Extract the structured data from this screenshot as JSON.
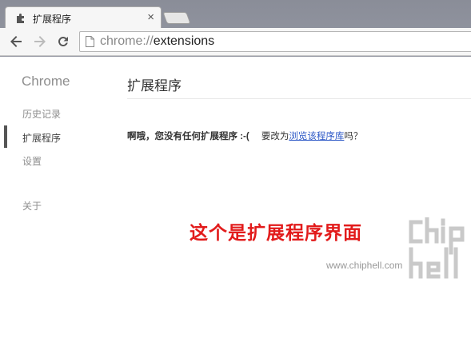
{
  "tab": {
    "title": "扩展程序",
    "close_glyph": "×"
  },
  "toolbar": {
    "url_scheme": "chrome://",
    "url_host": "extensions"
  },
  "sidebar": {
    "brand": "Chrome",
    "items": [
      {
        "label": "历史记录",
        "active": false
      },
      {
        "label": "扩展程序",
        "active": true
      },
      {
        "label": "设置",
        "active": false
      },
      {
        "label": "关于",
        "active": false
      }
    ]
  },
  "main": {
    "title": "扩展程序",
    "empty_message": "啊哦，您没有任何扩展程序 :-(",
    "suggestion_prefix": "要改为",
    "gallery_link": "浏览该程序库",
    "suggestion_suffix": "吗？"
  },
  "overlay": {
    "caption": "这个是扩展程序界面"
  },
  "watermark": {
    "url": "www.chiphell.com",
    "logo_text": "chip hell"
  },
  "colors": {
    "caption_red": "#e21b1b",
    "link_blue": "#2a56c6"
  }
}
